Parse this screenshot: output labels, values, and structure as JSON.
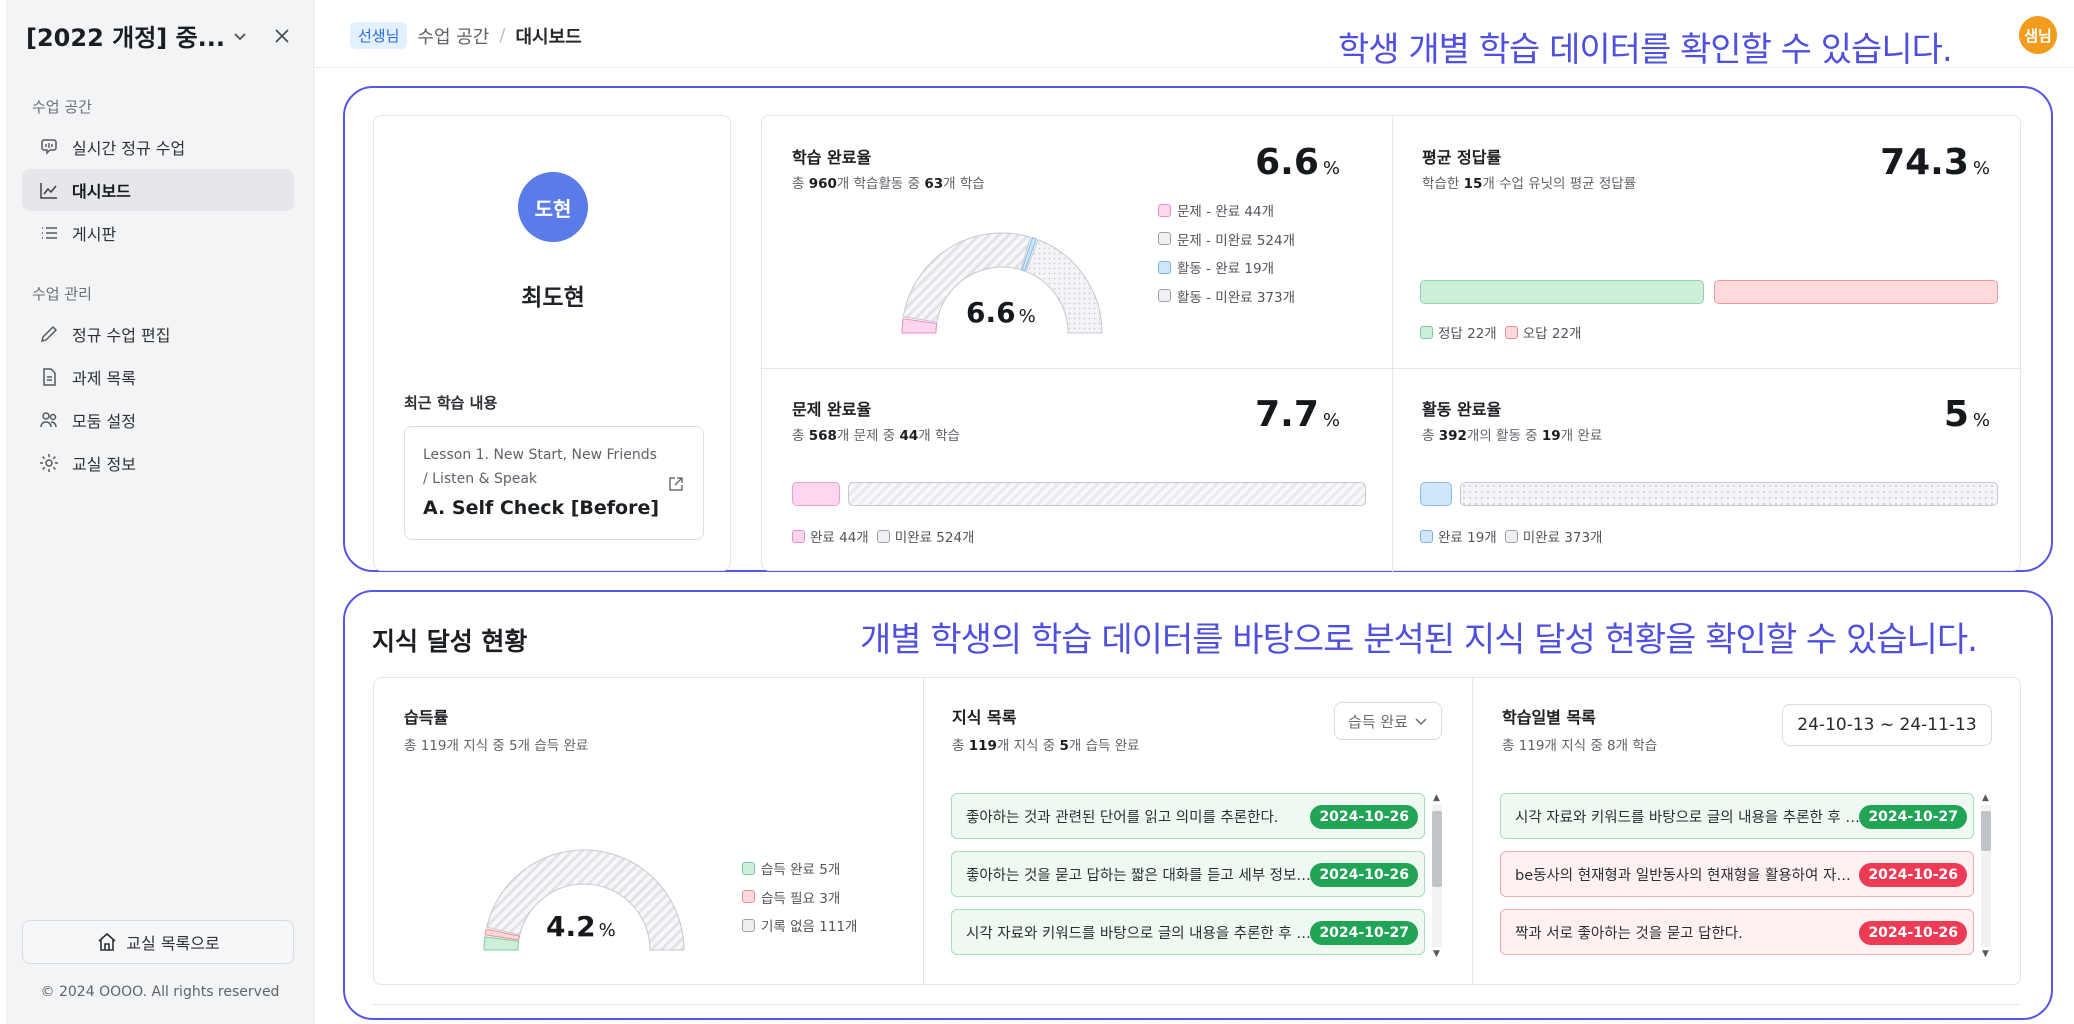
{
  "sidebar": {
    "title": "[2022 개정] 중...",
    "section1": "수업 공간",
    "section2": "수업 관리",
    "items": [
      {
        "label": "실시간 정규 수업"
      },
      {
        "label": "대시보드"
      },
      {
        "label": "게시판"
      },
      {
        "label": "정규 수업 편집"
      },
      {
        "label": "과제 목록"
      },
      {
        "label": "모둠 설정"
      },
      {
        "label": "교실 정보"
      }
    ],
    "back_button": "교실 목록으로",
    "copyright": "© 2024 OOOO. All rights reserved"
  },
  "topbar": {
    "badge": "선생님",
    "crumb1": "수업 공간",
    "separator": "/",
    "crumb2": "대시보드",
    "note": "학생 개별 학습 데이터를 확인할 수 있습니다.",
    "avatar": "샘님"
  },
  "profile": {
    "avatar": "도현",
    "name": "최도현",
    "recent_label": "최근 학습 내용",
    "lesson_sub": "Lesson 1. New Start, New Friends / Listen & Speak",
    "lesson_title": "A. Self Check [Before]"
  },
  "completion": {
    "title": "학습 완료율",
    "sub_pre": "총 ",
    "sub_total": "960",
    "sub_mid": "개 학습활동 중 ",
    "sub_done": "63",
    "sub_post": "개 학습",
    "value": "6.6",
    "unit": "%",
    "center_value": "6.6",
    "legend": [
      "문제 - 완료 44개",
      "문제 - 미완료 524개",
      "활동 - 완료 19개",
      "활동 - 미완료 373개"
    ],
    "gauge": {
      "problem_done": 44,
      "problem_todo": 524,
      "activity_done": 19,
      "activity_todo": 373
    }
  },
  "accuracy": {
    "title": "평균 정답률",
    "sub_pre": "학습한 ",
    "sub_num": "15",
    "sub_post": "개 수업 유닛의 평균 정답률",
    "value": "74.3",
    "unit": "%",
    "legend_correct": "정답 22개",
    "legend_wrong": "오답 22개",
    "correct": 22,
    "wrong": 22
  },
  "problem": {
    "title": "문제 완료율",
    "sub_pre": "총 ",
    "sub_total": "568",
    "sub_mid": "개 문제 중 ",
    "sub_done": "44",
    "sub_post": "개 학습",
    "value": "7.7",
    "unit": "%",
    "legend_done": "완료 44개",
    "legend_todo": "미완료 524개",
    "done": 44,
    "todo": 524
  },
  "activity": {
    "title": "활동 완료율",
    "sub_pre": "총 ",
    "sub_total": "392",
    "sub_mid": "개의 활동 중 ",
    "sub_done": "19",
    "sub_post": "개 완료",
    "value": "5",
    "unit": "%",
    "legend_done": "완료 19개",
    "legend_todo": "미완료 373개",
    "done": 19,
    "todo": 373
  },
  "knowledge": {
    "title": "지식 달성 현황",
    "note": "개별 학생의 학습 데이터를 바탕으로 분석된 지식 달성 현황을 확인할 수 있습니다.",
    "rate": {
      "title": "습득률",
      "sub": "총 119개 지식 중 5개 습득 완료",
      "value": "4.2",
      "unit": "%",
      "legend": [
        "습득 완료 5개",
        "습득 필요 3개",
        "기록 없음 111개"
      ],
      "gauge": {
        "acquired": 5,
        "needed": 3,
        "none": 111
      }
    },
    "list": {
      "title": "지식 목록",
      "sub_pre": "총 ",
      "sub_total": "119",
      "sub_mid": "개 지식 중 ",
      "sub_done": "5",
      "sub_post": "개 습득 완료",
      "filter": "습득 완료",
      "items": [
        {
          "text": "좋아하는 것과 관련된 단어를 읽고 의미를 추론한다.",
          "date": "2024-10-26"
        },
        {
          "text": "좋아하는 것을 묻고 답하는 짧은 대화를 듣고 세부 정보를 파악한다.",
          "date": "2024-10-26"
        },
        {
          "text": "시각 자료와 키워드를 바탕으로 글의 내용을 추론한 후 읽는다.",
          "date": "2024-10-27"
        }
      ]
    },
    "daily": {
      "title": "학습일별 목록",
      "sub": "총 119개 지식 중 8개 학습",
      "range": "24-10-13 ~ 24-11-13",
      "items": [
        {
          "text": "시각 자료와 키워드를 바탕으로 글의 내용을 추론한 후 읽는다.",
          "date": "2024-10-27",
          "status": "ok"
        },
        {
          "text": "be동사의 현재형과 일반동사의 현재형을 활용하여 자신을 소개한다.",
          "date": "2024-10-26",
          "status": "bad"
        },
        {
          "text": "짝과 서로 좋아하는 것을 묻고 답한다.",
          "date": "2024-10-26",
          "status": "bad"
        }
      ]
    }
  },
  "colors": {
    "accent": "#5656e6",
    "avatar_blue": "#5a7be8",
    "avatar_orange": "#f29b1c",
    "green": "#22a456",
    "red": "#ee3b55"
  }
}
